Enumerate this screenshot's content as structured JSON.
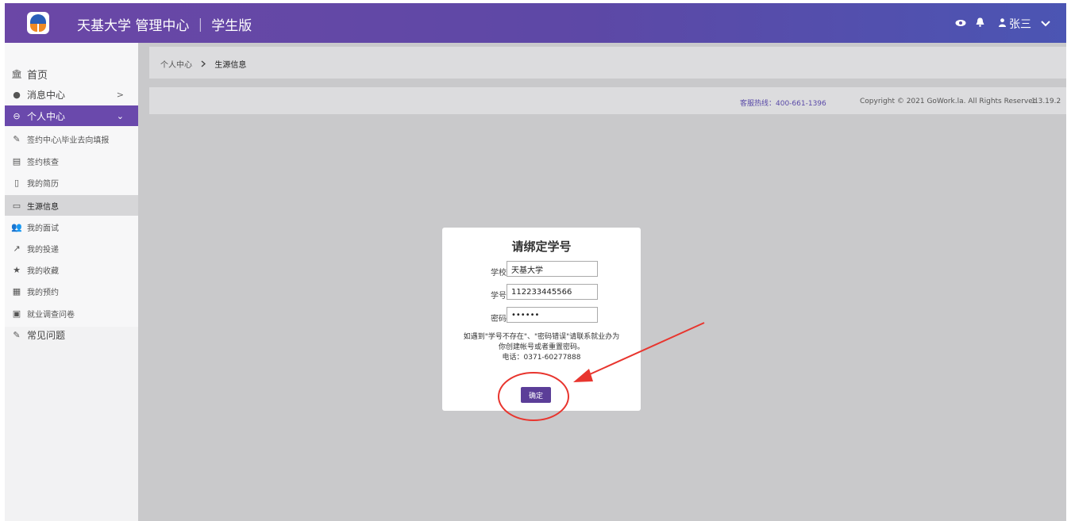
{
  "header": {
    "title": "天基大学 管理中心 ｜ 学生版",
    "user_name": "张三"
  },
  "breadcrumb": {
    "parent": "个人中心",
    "current": "生源信息"
  },
  "footer_info": {
    "hotline": "客服热线：400-661-1396",
    "copyright": "Copyright © 2021 GoWork.la. All Rights Reserved",
    "version": "1.3.19.2"
  },
  "sidebar": {
    "items": [
      {
        "label": "首页"
      },
      {
        "label": "消息中心",
        "arrow": ">"
      },
      {
        "label": "个人中心",
        "arrow": "⌄"
      },
      {
        "label": "签约中心\\毕业去向填报"
      },
      {
        "label": "签约核查"
      },
      {
        "label": "我的简历"
      },
      {
        "label": "生源信息"
      },
      {
        "label": "我的面试"
      },
      {
        "label": "我的投递"
      },
      {
        "label": "我的收藏"
      },
      {
        "label": "我的预约"
      },
      {
        "label": "就业调查问卷"
      },
      {
        "label": "常见问题"
      }
    ]
  },
  "dialog": {
    "title": "请绑定学号",
    "school_label": "学校",
    "school_value": "天基大学",
    "id_label": "学号",
    "id_value": "112233445566",
    "password_label": "密码",
    "password_value": "••••••",
    "note_line1": "如遇到\"学号不存在\"、\"密码错误\"请联系就业办为",
    "note_line2": "你创建帐号或者重置密码。",
    "note_line3": "电话：0371-60277888",
    "confirm_label": "确定"
  },
  "colors": {
    "header_start": "#6b47a6",
    "header_end": "#4b55b3",
    "accent": "#6a49ac",
    "button": "#5b3e98",
    "annotation": "#e8352e"
  }
}
